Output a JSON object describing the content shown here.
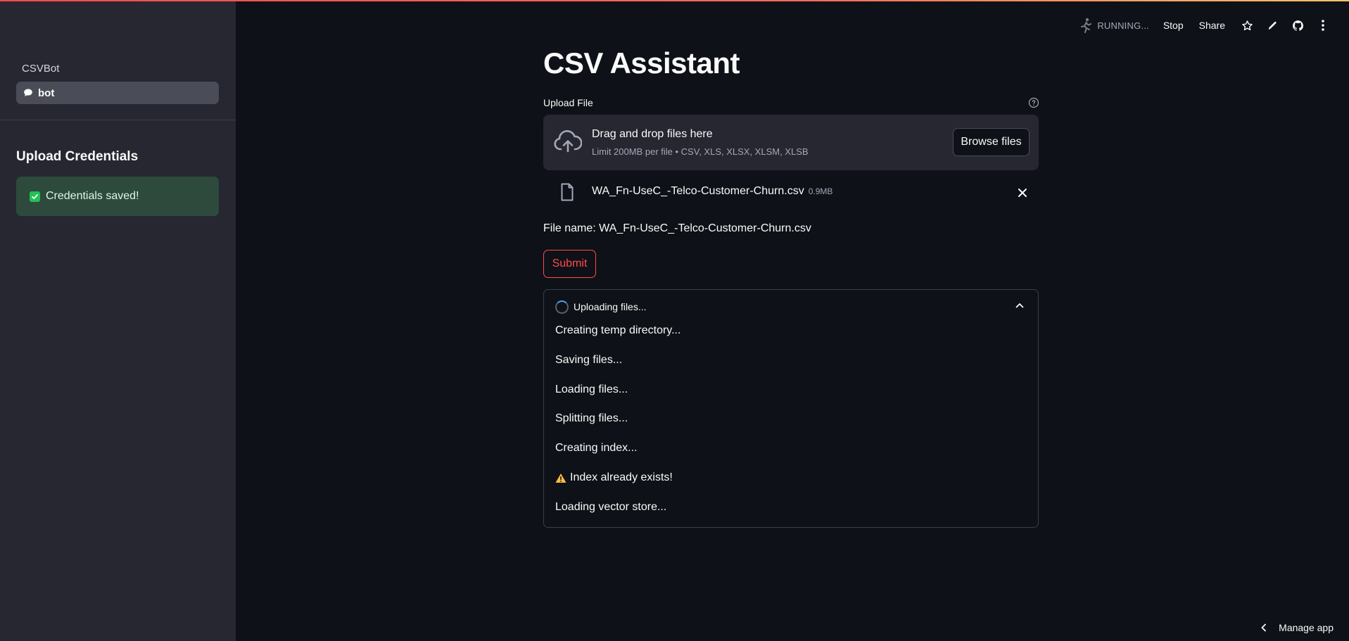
{
  "sidebar": {
    "nav_header": "CSVBot",
    "nav_items": [
      {
        "label": "bot",
        "icon": "chat-bubble-icon"
      }
    ],
    "heading": "Upload Credentials",
    "success_message": "Credentials saved!"
  },
  "toolbar": {
    "status": "RUNNING...",
    "stop": "Stop",
    "share": "Share",
    "icons": [
      "star-icon",
      "pencil-icon",
      "github-icon",
      "more-vertical-icon"
    ]
  },
  "main": {
    "title": "CSV Assistant",
    "upload": {
      "label": "Upload File",
      "drop_title": "Drag and drop files here",
      "limit": "Limit 200MB per file • CSV, XLS, XLSX, XLSM, XLSB",
      "browse": "Browse files",
      "file": {
        "name": "WA_Fn-UseC_-Telco-Customer-Churn.csv",
        "size": "0.9MB"
      }
    },
    "file_name_line": "File name: WA_Fn-UseC_-Telco-Customer-Churn.csv",
    "submit": "Submit",
    "status": {
      "title": "Uploading files...",
      "lines": [
        {
          "text": "Creating temp directory...",
          "warn": false
        },
        {
          "text": "Saving files...",
          "warn": false
        },
        {
          "text": "Loading files...",
          "warn": false
        },
        {
          "text": "Splitting files...",
          "warn": false
        },
        {
          "text": "Creating index...",
          "warn": false
        },
        {
          "text": "Index already exists!",
          "warn": true
        },
        {
          "text": "Loading vector store...",
          "warn": false
        }
      ]
    }
  },
  "footer": {
    "manage_app": "Manage app"
  },
  "colors": {
    "accent": "#ff4b4b",
    "success_bg": "#2d4a3c",
    "success_check": "#21c354",
    "warning": "#ffbd45",
    "sidebar_bg": "#262730",
    "app_bg": "#0e1117"
  }
}
